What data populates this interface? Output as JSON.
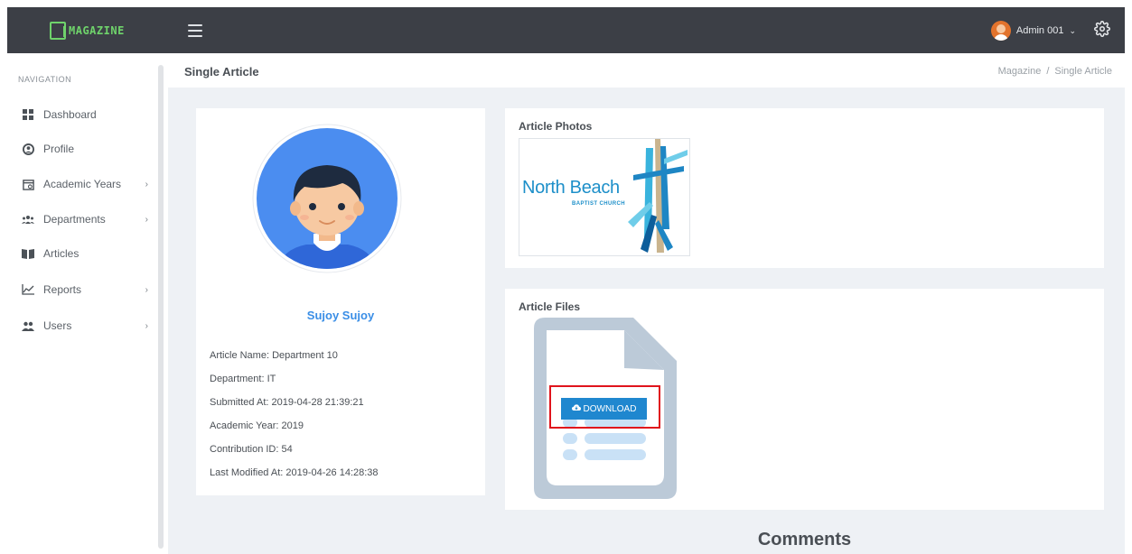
{
  "app": {
    "logo_text": "MAGAZINE"
  },
  "header": {
    "user_name": "Admin 001",
    "caret": "⌄"
  },
  "sidebar": {
    "heading": "NAVIGATION",
    "items": [
      {
        "label": "Dashboard",
        "icon": "dashboard-icon",
        "has_children": false
      },
      {
        "label": "Profile",
        "icon": "user-circle-icon",
        "has_children": false
      },
      {
        "label": "Academic Years",
        "icon": "calendar-icon",
        "has_children": true
      },
      {
        "label": "Departments",
        "icon": "group-icon",
        "has_children": true
      },
      {
        "label": "Articles",
        "icon": "book-icon",
        "has_children": false
      },
      {
        "label": "Reports",
        "icon": "chart-line-icon",
        "has_children": true
      },
      {
        "label": "Users",
        "icon": "users-icon",
        "has_children": true
      }
    ],
    "chevron": "›"
  },
  "page": {
    "title": "Single Article",
    "breadcrumb": [
      "Magazine",
      "/",
      "Single Article"
    ]
  },
  "profile": {
    "name": "Sujoy Sujoy",
    "details": [
      "Article Name: Department 10",
      "Department: IT",
      "Submitted At: 2019-04-28 21:39:21",
      "Academic Year: 2019",
      "Contribution ID: 54",
      "Last Modified At: 2019-04-26 14:28:38"
    ]
  },
  "photos": {
    "title": "Article Photos",
    "image_text": "North Beach",
    "image_subtext": "BAPTIST CHURCH"
  },
  "files": {
    "title": "Article Files",
    "download_label": "DOWNLOAD"
  },
  "comments": {
    "heading": "Comments"
  },
  "colors": {
    "topbar": "#3c3f46",
    "accent": "#1f87cf",
    "logo": "#6fd36b",
    "highlight": "#e0141c",
    "name": "#3a8ee6"
  }
}
